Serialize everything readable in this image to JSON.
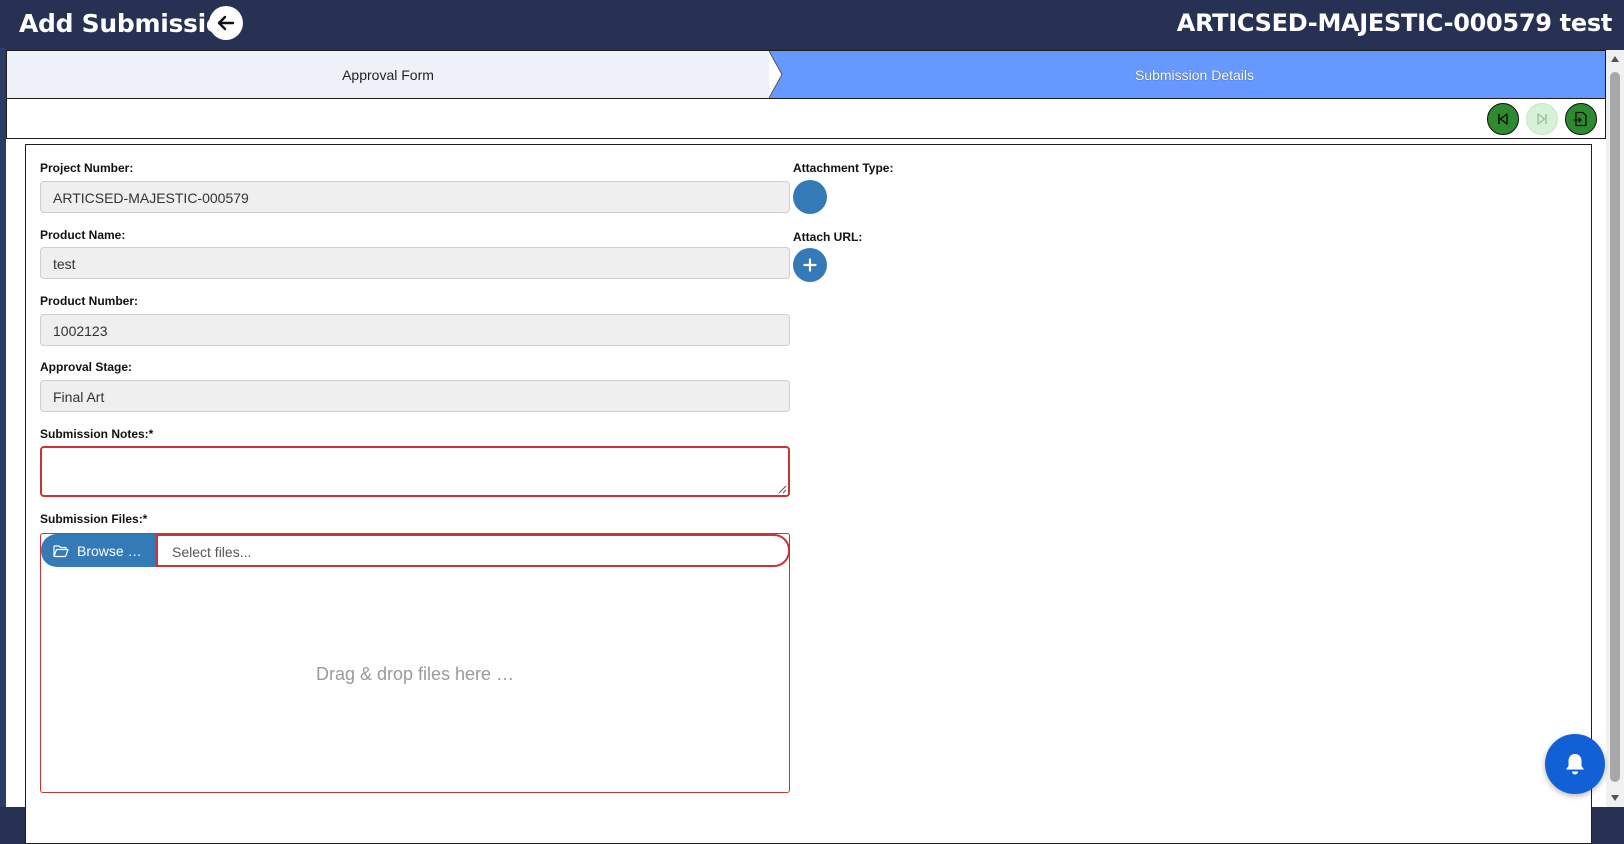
{
  "header": {
    "title": "Add Submission",
    "project_title": "ARTICSED-MAJESTIC-000579 test"
  },
  "stepper": {
    "steps": [
      {
        "label": "Approval Form"
      },
      {
        "label": "Submission Details"
      }
    ],
    "active_index": 1
  },
  "colors": {
    "header_bg": "#273154",
    "active_step": "#6699ff",
    "primary": "#337ab7",
    "error_border": "#c9333a",
    "toolbar_green": "#2e8a2e",
    "notification": "#1160d6"
  },
  "form": {
    "project_number": {
      "label": "Project Number:",
      "value": "ARTICSED-MAJESTIC-000579"
    },
    "product_name": {
      "label": "Product Name:",
      "value": "test"
    },
    "product_number": {
      "label": "Product Number:",
      "value": "1002123"
    },
    "approval_stage": {
      "label": "Approval Stage:",
      "value": "Final Art"
    },
    "submission_notes": {
      "label": "Submission Notes:*",
      "value": ""
    },
    "submission_files": {
      "label": "Submission Files:*",
      "browse_label": "Browse …",
      "placeholder": "Select files...",
      "drop_text": "Drag & drop files here …"
    },
    "attachment_type": {
      "label": "Attachment Type:"
    },
    "attach_url": {
      "label": "Attach URL:",
      "button_icon": "plus-icon"
    }
  },
  "toolbar": {
    "buttons": [
      {
        "icon": "skip-back-icon",
        "enabled": true
      },
      {
        "icon": "skip-forward-icon",
        "enabled": false
      },
      {
        "icon": "submit-document-icon",
        "enabled": true
      }
    ]
  },
  "notification": {
    "icon": "bell-icon"
  }
}
